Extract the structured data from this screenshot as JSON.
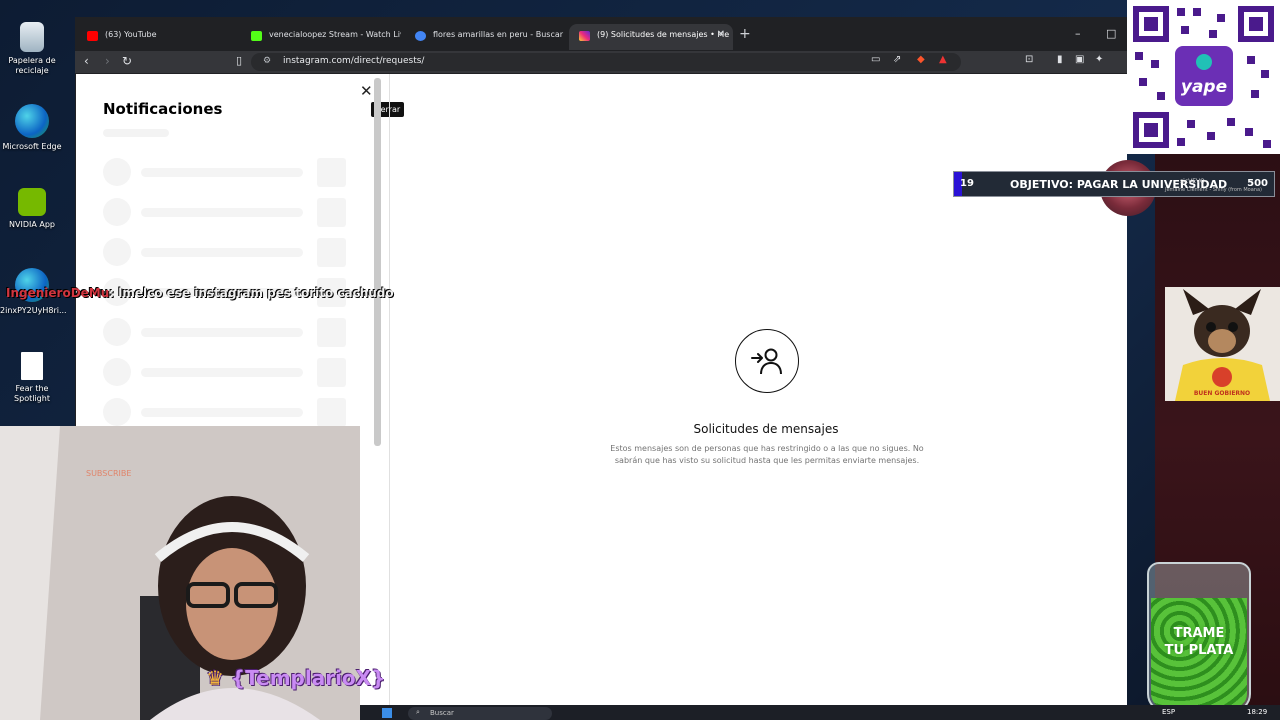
{
  "desktop": {
    "icons": [
      {
        "label": "Papelera de reciclaje",
        "icon": "recycle-bin-icon"
      },
      {
        "label": "Microsoft Edge",
        "icon": "edge-icon"
      },
      {
        "label": "NVIDIA App",
        "icon": "nvidia-icon"
      },
      {
        "label": "2inxPY2UyH8ri...",
        "icon": "edge-icon"
      },
      {
        "label": "Fear the Spotlight",
        "icon": "file-icon"
      }
    ]
  },
  "browser": {
    "tabs": [
      {
        "label": "(63) YouTube",
        "active": false,
        "favicon_color": "#ff0000"
      },
      {
        "label": "venecialoopez Stream - Watch Live o",
        "active": false,
        "favicon_color": "#53fc18"
      },
      {
        "label": "flores amarillas en peru - Buscar con",
        "active": false,
        "favicon_color": "#4285f4"
      },
      {
        "label": "(9) Solicitudes de mensajes • Me",
        "active": true,
        "favicon_color": "#e1306c"
      }
    ],
    "new_tab": "+",
    "window_controls": {
      "minimize": "–",
      "maximize": "□"
    },
    "url": "instagram.com/direct/requests/"
  },
  "instagram": {
    "notifications_title": "Notificaciones",
    "close_tooltip": "Cerrar",
    "requests_title": "Solicitudes de mensajes",
    "requests_description": "Estos mensajes son de personas que has restringido o a las que no sigues. No sabrán que has visto su solicitud hasta que les permitas enviarte mensajes."
  },
  "stream_overlay": {
    "goal": {
      "current": "19",
      "label": "OBJETIVO: PAGAR LA UNIVERSIDAD",
      "target": "500"
    },
    "now_playing": {
      "line1": "sicVEVO",
      "line2": "Jemaine Clement - Shiny (from Moana)"
    },
    "chat": {
      "user": "IngenieroDeMu",
      "message": ": lmelco ese instagram pes torito cachudo"
    },
    "alert_name": "{TemplarioX}",
    "jar_text": [
      "TRAME",
      "TU PLATA"
    ],
    "dog_caption": "BUEN GOBIERNO",
    "qr_brand": "yape",
    "webcam_sticker": "SUBSCRIBE"
  },
  "taskbar": {
    "search_placeholder": "Buscar",
    "language": "ESP",
    "time": "18:29"
  },
  "colors": {
    "accent_goal": "#2a12d6",
    "chat_user": "#d1353f",
    "alert": "#c98bf3"
  }
}
